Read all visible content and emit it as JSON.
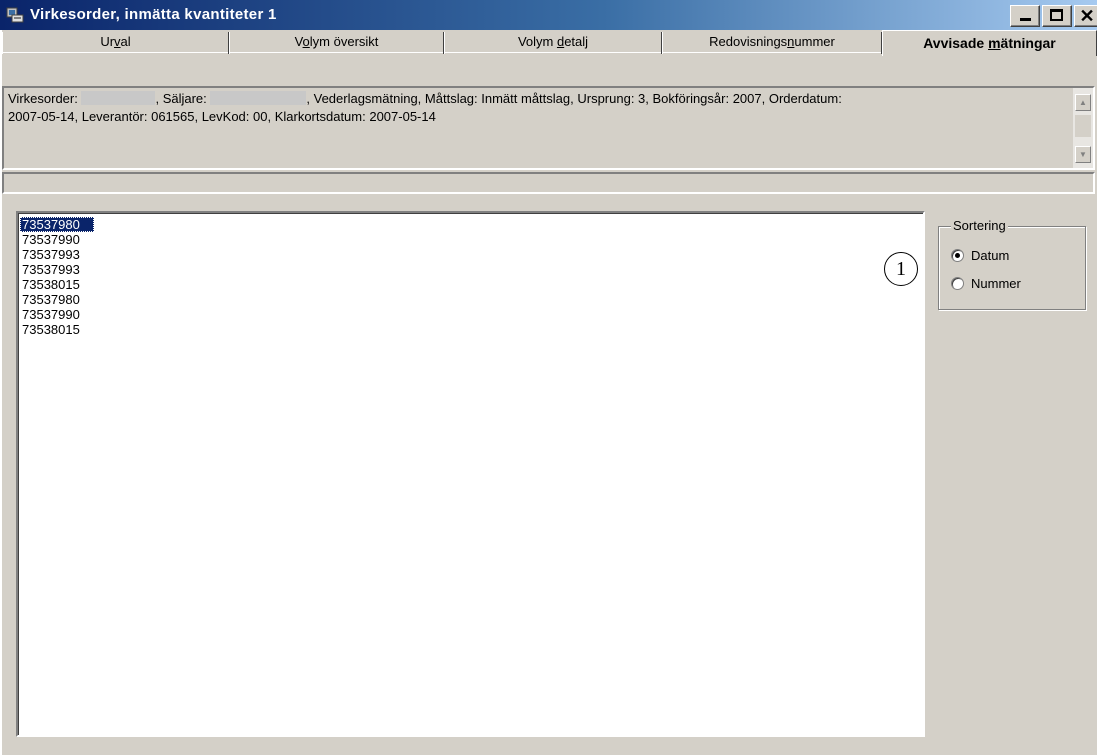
{
  "window": {
    "title": "Virkesorder, inmätta kvantiteter 1",
    "title_bar_color": "#0a246a"
  },
  "tabs": [
    {
      "pre": "Ur",
      "u": "v",
      "post": "al",
      "selected": false
    },
    {
      "pre": "V",
      "u": "o",
      "post": "lym översikt",
      "selected": false
    },
    {
      "pre": "Volym ",
      "u": "d",
      "post": "etalj",
      "selected": false
    },
    {
      "pre": "Redovisnings",
      "u": "n",
      "post": "ummer",
      "selected": false
    },
    {
      "pre": "Avvisade ",
      "u": "m",
      "post": "ätningar",
      "selected": true
    }
  ],
  "info": {
    "line1_a": "Virkesorder: ",
    "line1_b": ", Säljare: ",
    "line1_c": ", Vederlagsmätning, Måttslag: Inmätt måttslag, Ursprung: 3, Bokföringsår: 2007, Orderdatum:",
    "line2": "2007-05-14, Leverantör: 061565, LevKod: 00, Klarkortsdatum: 2007-05-14"
  },
  "list": {
    "items": [
      "73537980",
      "73537990",
      "73537993",
      "73537993",
      "73538015",
      "73537980",
      "73537990",
      "73538015"
    ],
    "selected_index": 0,
    "selection_color": "#0a246a"
  },
  "sorting": {
    "label": "Sortering",
    "options": [
      {
        "label": "Datum",
        "checked": true
      },
      {
        "label": "Nummer",
        "checked": false
      }
    ]
  },
  "callout": {
    "number": "1"
  }
}
